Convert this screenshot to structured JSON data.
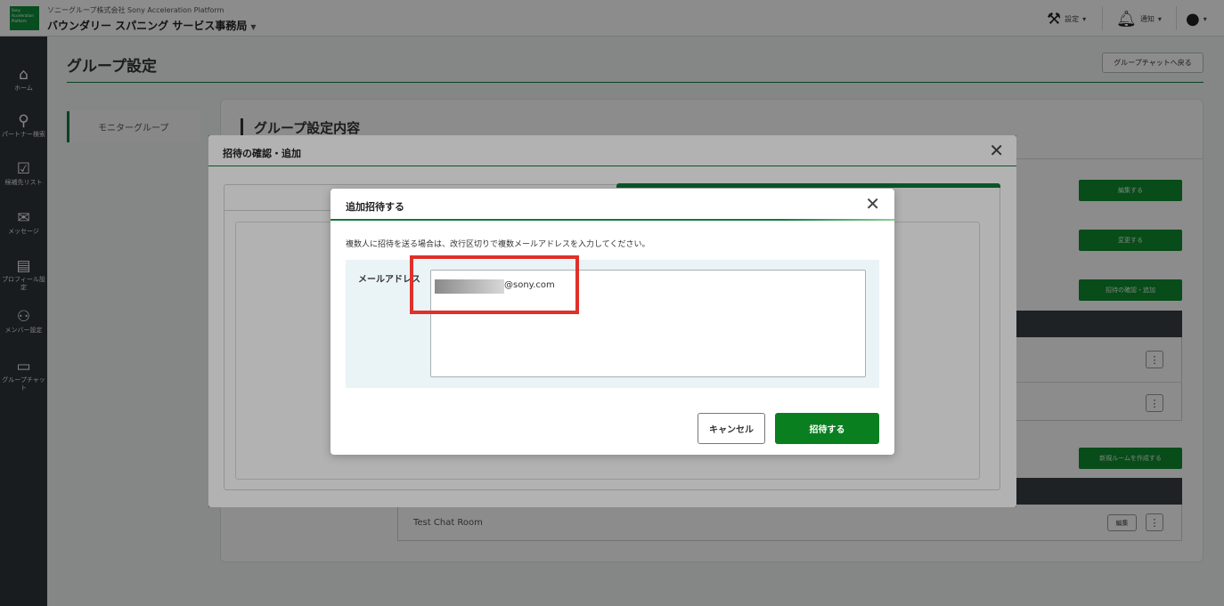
{
  "header": {
    "logo_text": "Sony Acceleration Platform",
    "org_subtitle": "ソニーグループ株式会社 Sony Acceleration Platform",
    "org_name": "バウンダリー スパニング サービス事務局",
    "settings_label": "設定",
    "notifications_label": "通知"
  },
  "sidebar": {
    "items": [
      {
        "label": "ホーム"
      },
      {
        "label": "パートナー検索"
      },
      {
        "label": "候補先リスト"
      },
      {
        "label": "メッセージ"
      },
      {
        "label": "プロフィール設定"
      },
      {
        "label": "メンバー設定"
      },
      {
        "label": "グループチャット"
      }
    ]
  },
  "page": {
    "title": "グループ設定",
    "back_button": "グループチャットへ戻る",
    "subnav_item": "モニターグループ",
    "section_title": "グループ設定内容",
    "buttons": {
      "edit": "編集する",
      "change": "変更する",
      "invite_confirm": "招待の確認・追加",
      "new_room": "新規ルームを作成する"
    },
    "room_name": "Test Chat Room",
    "room_edit": "編集"
  },
  "dialog_outer": {
    "title": "招待の確認・追加"
  },
  "dialog_inner": {
    "title": "追加招待する",
    "description": "複数人に招待を送る場合は、改行区切りで複数メールアドレスを入力してください。",
    "email_label": "メールアドレス",
    "email_value_suffix": "@sony.com",
    "cancel_label": "キャンセル",
    "invite_label": "招待する"
  },
  "colors": {
    "brand_green": "#0f7a3d",
    "button_green": "#0a7f20",
    "highlight_red": "#e0302a",
    "sidebar_bg": "#2f3437"
  }
}
